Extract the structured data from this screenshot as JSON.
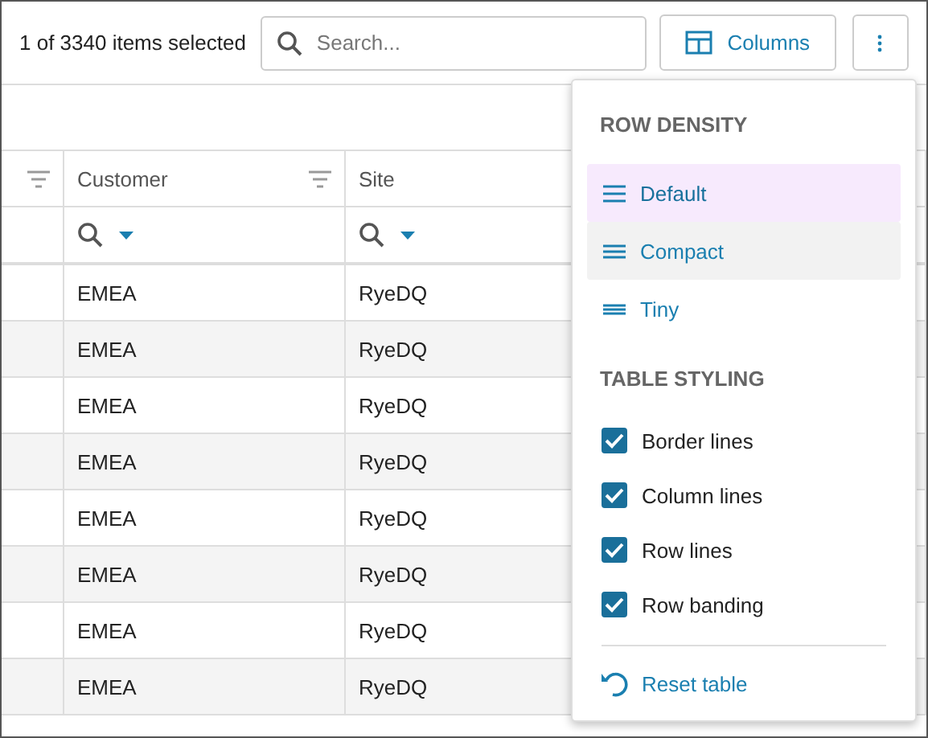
{
  "toolbar": {
    "selection_count": "1 of 3340 items selected",
    "search": {
      "placeholder": "Search..."
    },
    "columns_button": "Columns"
  },
  "table": {
    "columns": [
      {
        "filter": true
      },
      {
        "label": "Customer",
        "filter": true
      },
      {
        "label": "Site",
        "filter": false
      },
      {
        "filter": false
      }
    ],
    "filter_row": [
      false,
      true,
      true,
      false
    ],
    "rows": [
      {
        "customer": "EMEA",
        "site": "RyeDQ"
      },
      {
        "customer": "EMEA",
        "site": "RyeDQ"
      },
      {
        "customer": "EMEA",
        "site": "RyeDQ"
      },
      {
        "customer": "EMEA",
        "site": "RyeDQ"
      },
      {
        "customer": "EMEA",
        "site": "RyeDQ"
      },
      {
        "customer": "EMEA",
        "site": "RyeDQ"
      },
      {
        "customer": "EMEA",
        "site": "RyeDQ"
      },
      {
        "customer": "EMEA",
        "site": "RyeDQ"
      }
    ]
  },
  "menu": {
    "density_heading": "ROW DENSITY",
    "density": [
      {
        "label": "Default",
        "selected": true,
        "hovered": false,
        "kind": "default"
      },
      {
        "label": "Compact",
        "selected": false,
        "hovered": true,
        "kind": "compact"
      },
      {
        "label": "Tiny",
        "selected": false,
        "hovered": false,
        "kind": "tiny"
      }
    ],
    "styling_heading": "TABLE STYLING",
    "styling": [
      {
        "label": "Border lines",
        "checked": true,
        "kind": "border"
      },
      {
        "label": "Column lines",
        "checked": true,
        "kind": "column"
      },
      {
        "label": "Row lines",
        "checked": true,
        "kind": "row"
      },
      {
        "label": "Row banding",
        "checked": true,
        "kind": "banding"
      }
    ],
    "reset": "Reset table"
  }
}
